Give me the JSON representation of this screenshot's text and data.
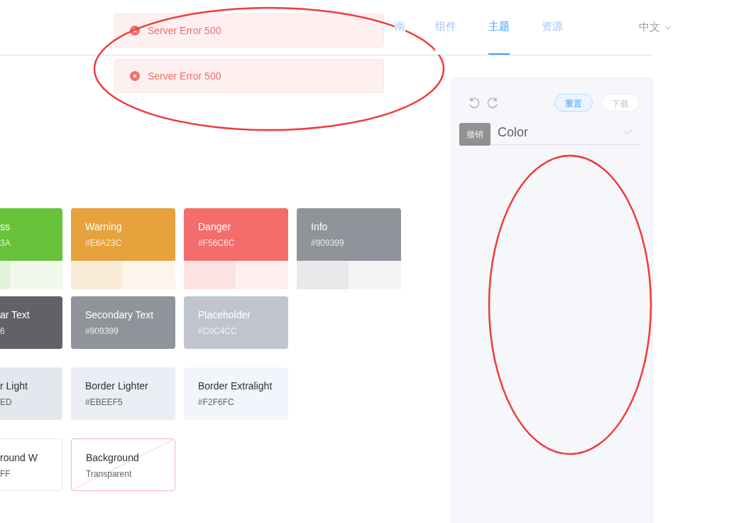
{
  "nav": {
    "items": [
      {
        "label": "南",
        "selected": false
      },
      {
        "label": "组件",
        "selected": false
      },
      {
        "label": "主题",
        "selected": true
      },
      {
        "label": "资源",
        "selected": false
      }
    ],
    "language": "中文"
  },
  "messages": [
    {
      "kind": "error",
      "text": "Server Error 500"
    },
    {
      "kind": "error",
      "text": "Server Error 500"
    }
  ],
  "panel": {
    "reset": "重置",
    "download": "下载",
    "tooltip": "撤销",
    "select": "Color"
  },
  "palette": [
    {
      "cards": [
        {
          "kind": "solid",
          "cut": true,
          "name": "ss",
          "value": "3A",
          "color": "#67c23a",
          "tints": [
            {
              "color": "#e1f3d8"
            },
            {
              "color": "#f0f9eb"
            }
          ]
        },
        {
          "kind": "solid",
          "cut": false,
          "name": "Warning",
          "value": "#E6A23C",
          "color": "#e6a23c",
          "tints": [
            {
              "color": "#faecd8"
            },
            {
              "color": "#fdf6ec"
            }
          ]
        },
        {
          "kind": "solid",
          "cut": false,
          "name": "Danger",
          "value": "#F56C6C",
          "color": "#f56c6c",
          "tints": [
            {
              "color": "#fde2e2"
            },
            {
              "color": "#fef0f0"
            }
          ]
        },
        {
          "kind": "solid",
          "cut": false,
          "name": "Info",
          "value": "#909399",
          "color": "#909399",
          "tints": [
            {
              "color": "#e9e9eb"
            },
            {
              "color": "#f4f4f5"
            }
          ]
        }
      ]
    },
    {
      "cards": [
        {
          "kind": "solid",
          "cut": true,
          "name": "ar Text",
          "value": "6",
          "color": "#606266"
        },
        {
          "kind": "solid",
          "cut": false,
          "name": "Secondary Text",
          "value": "#909399",
          "color": "#909399"
        },
        {
          "kind": "solid",
          "cut": false,
          "name": "Placeholder",
          "value": "#C0C4CC",
          "color": "#c0c4cc"
        }
      ]
    },
    {
      "cards": [
        {
          "kind": "light",
          "cut": true,
          "name": "r Light",
          "value": "ED",
          "color": "#e4e7ed"
        },
        {
          "kind": "light",
          "cut": false,
          "name": "Border Lighter",
          "value": "#EBEEF5",
          "color": "#ebeef5"
        },
        {
          "kind": "light",
          "cut": false,
          "name": "Border Extralight",
          "value": "#F2F6FC",
          "color": "#f2f6fc"
        }
      ]
    },
    {
      "cards": [
        {
          "kind": "outline",
          "cut": true,
          "name": "round W",
          "value": "FF",
          "color": "#ffffff"
        },
        {
          "kind": "transparent",
          "cut": false,
          "name": "Background",
          "value": "Transparent"
        }
      ]
    }
  ]
}
